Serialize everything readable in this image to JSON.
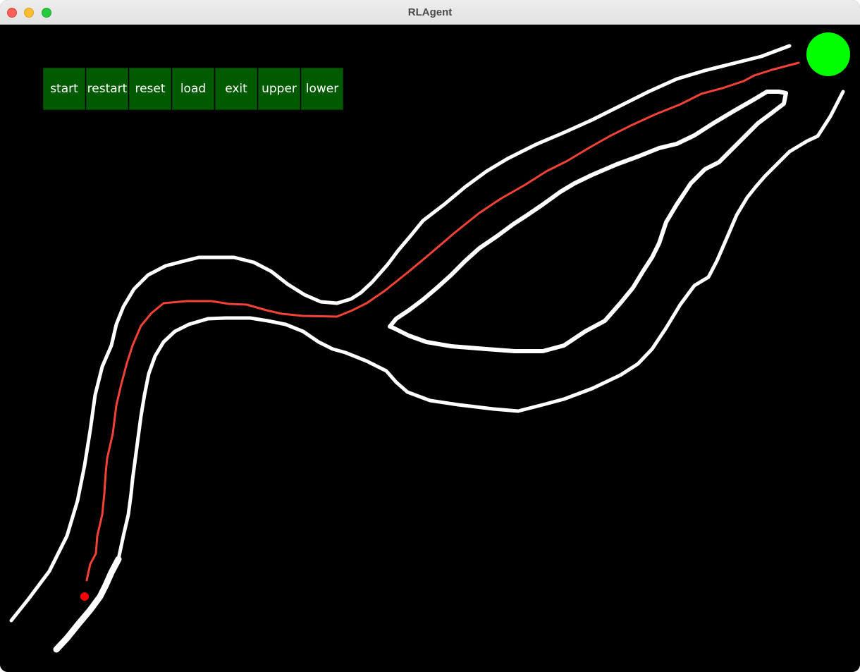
{
  "window": {
    "title": "RLAgent"
  },
  "toolbar": {
    "buttons": [
      {
        "label": "start"
      },
      {
        "label": "restart"
      },
      {
        "label": "reset"
      },
      {
        "label": "load"
      },
      {
        "label": "exit"
      },
      {
        "label": "upper"
      },
      {
        "label": "lower"
      }
    ]
  },
  "colors": {
    "background": "#000000",
    "track": "#ffffff",
    "agent_path": "#f44336",
    "agent": "#ff0000",
    "goal": "#00ff00",
    "button": "#005a00"
  }
}
